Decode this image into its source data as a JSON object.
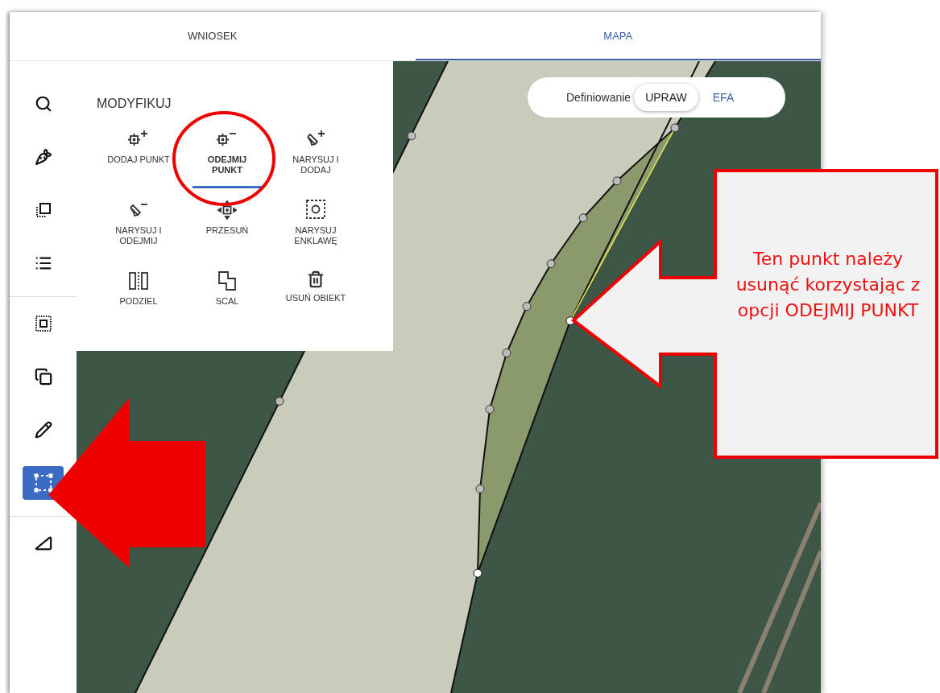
{
  "tabs": [
    {
      "label": "WNIOSEK",
      "selected": false
    },
    {
      "label": "MAPA",
      "selected": true
    }
  ],
  "sidebar": {
    "groups": [
      [
        {
          "kind": "search",
          "selected": false
        },
        {
          "kind": "crop",
          "selected": false
        },
        {
          "kind": "layer",
          "selected": false
        },
        {
          "kind": "list",
          "selected": false
        }
      ],
      [
        {
          "kind": "select-area",
          "selected": false
        },
        {
          "kind": "copy",
          "selected": false
        },
        {
          "kind": "pencil",
          "selected": false
        },
        {
          "kind": "edit-shape",
          "selected": true
        }
      ],
      [
        {
          "kind": "measure",
          "selected": false
        }
      ]
    ]
  },
  "modify_panel": {
    "title": "MODYFIKUJ",
    "tools": [
      {
        "label": "DODAJ PUNKT",
        "kind": "add-point",
        "selected": false
      },
      {
        "label": "ODEJMIJ PUNKT",
        "kind": "remove-point",
        "selected": true
      },
      {
        "label": "NARYSUJ I DODAJ",
        "kind": "draw-add",
        "selected": false
      },
      {
        "label": "NARYSUJ I ODEJMIJ",
        "kind": "draw-remove",
        "selected": false
      },
      {
        "label": "PRZESUŃ",
        "kind": "move",
        "selected": false
      },
      {
        "label": "NARYSUJ ENKLAWĘ",
        "kind": "enclave",
        "selected": false
      },
      {
        "label": "PODZIEL",
        "kind": "split",
        "selected": false
      },
      {
        "label": "SCAL",
        "kind": "merge",
        "selected": false
      },
      {
        "label": "USUŃ OBIEKT",
        "kind": "delete",
        "selected": false
      }
    ]
  },
  "mode_toggle": {
    "label": "Definiowanie",
    "options": [
      {
        "label": "UPRAW",
        "selected": true
      },
      {
        "label": "EFA",
        "selected": false
      }
    ]
  },
  "annotation": {
    "callout_text": "Ten punkt należy usunąć korzystając z opcji ODEJMIJ PUNKT"
  }
}
